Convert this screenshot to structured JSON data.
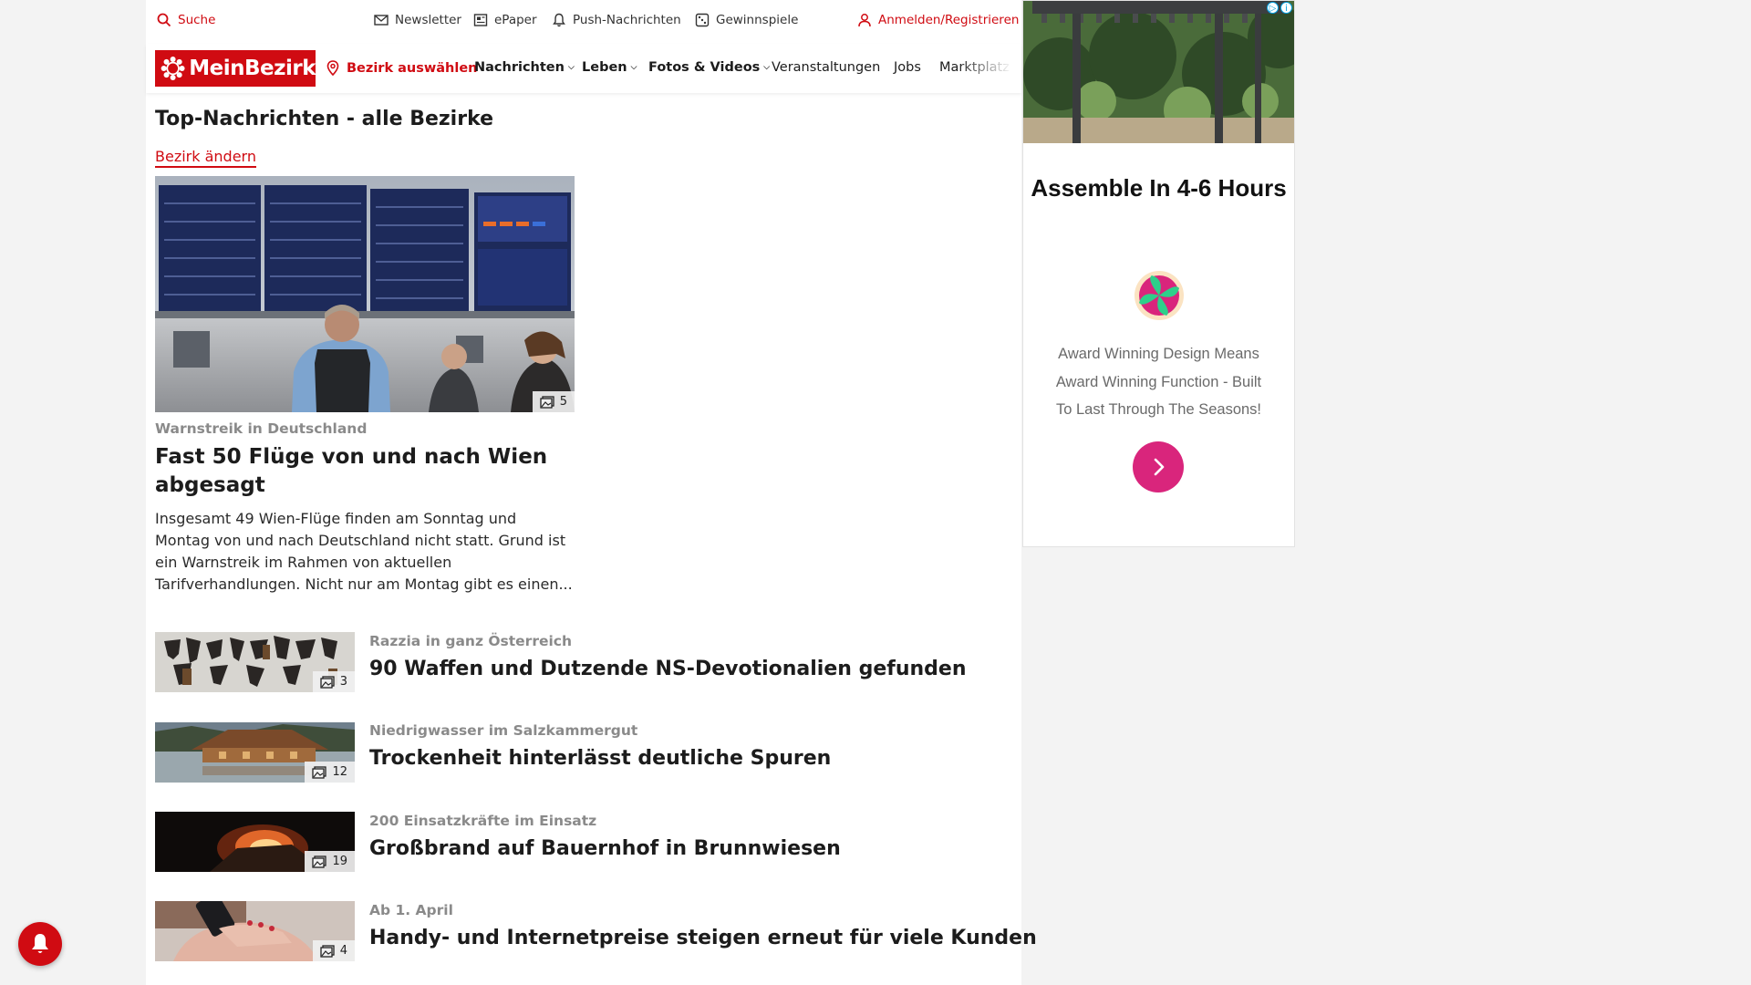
{
  "utility_bar": {
    "search_label": "Suche",
    "newsletter_label": "Newsletter",
    "epaper_label": "ePaper",
    "push_label": "Push-Nachrichten",
    "contests_label": "Gewinnspiele",
    "login_label": "Anmelden/Registrieren"
  },
  "nav": {
    "logo_text": "MeinBezirk",
    "bezirk_label": "Bezirk auswählen",
    "items": [
      {
        "label": "Nachrichten"
      },
      {
        "label": "Leben"
      },
      {
        "label": "Fotos & Videos"
      },
      {
        "label": "Veranstaltungen"
      },
      {
        "label": "Jobs"
      },
      {
        "label": "Marktplatz"
      }
    ]
  },
  "section": {
    "title": "Top-Nachrichten - alle Bezirke",
    "change_link": "Bezirk ändern"
  },
  "top_story": {
    "photo_count": "5",
    "kicker": "Warnstreik in Deutschland",
    "title": "Fast 50 Flüge von und nach Wien abgesagt",
    "teaser": "Insgesamt 49 Wien-Flüge finden am Sonntag und Montag von und nach Deutschland nicht statt. Grund ist ein Warnstreik im Rahmen von aktuellen Tarifverhandlungen. Nicht nur am Montag gibt es einen..."
  },
  "articles": [
    {
      "photo_count": "3",
      "kicker": "Razzia in ganz Österreich",
      "title": "90 Waffen und Dutzende NS-Devotionalien gefunden"
    },
    {
      "photo_count": "12",
      "kicker": "Niedrigwasser im Salzkammergut",
      "title": "Trockenheit hinterlässt deutliche Spuren"
    },
    {
      "photo_count": "19",
      "kicker": "200 Einsatzkräfte im Einsatz",
      "title": "Großbrand auf Bauernhof in Brunnwiesen"
    },
    {
      "photo_count": "4",
      "kicker": "Ab 1. April",
      "title": "Handy- und Internetpreise steigen erneut für viele Kunden"
    }
  ],
  "ad": {
    "title": "Assemble In 4-6 Hours",
    "body": "Award Winning Design Means Award Winning Function - Built To Last Through The Seasons!",
    "accent_color": "#d9257c"
  },
  "colors": {
    "brand_red": "#d00b12",
    "kicker_gray": "#8a8a8a"
  }
}
